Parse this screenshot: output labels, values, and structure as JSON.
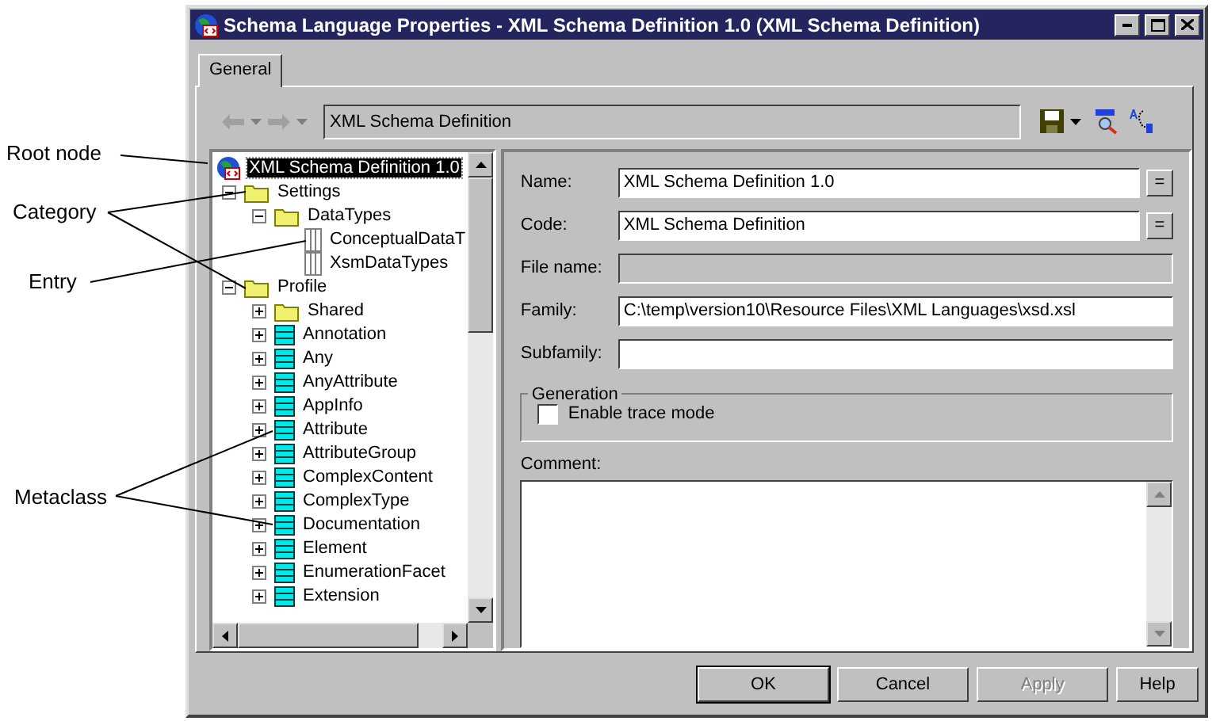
{
  "window": {
    "title": "Schema Language Properties - XML Schema Definition 1.0 (XML Schema Definition)"
  },
  "tabs": [
    {
      "label": "General",
      "selected": true
    }
  ],
  "toolbar": {
    "path": "XML Schema Definition"
  },
  "tree": [
    {
      "label": "XML Schema Definition 1.0",
      "kind": "root",
      "selected": true,
      "children": [
        {
          "label": "Settings",
          "kind": "folder",
          "expanded": true,
          "selected": false,
          "children": [
            {
              "label": "DataTypes",
              "kind": "folder",
              "expanded": true,
              "selected": false,
              "children": [
                {
                  "label": "ConceptualDataT",
                  "kind": "entry",
                  "selected": false
                },
                {
                  "label": "XsmDataTypes",
                  "kind": "entry",
                  "selected": false
                }
              ]
            }
          ]
        },
        {
          "label": "Profile",
          "kind": "folder",
          "expanded": true,
          "selected": false,
          "children": [
            {
              "label": "Shared",
              "kind": "folder",
              "expanded": false,
              "selected": false
            },
            {
              "label": "Annotation",
              "kind": "metaclass",
              "expanded": false,
              "selected": false
            },
            {
              "label": "Any",
              "kind": "metaclass",
              "expanded": false,
              "selected": false
            },
            {
              "label": "AnyAttribute",
              "kind": "metaclass",
              "expanded": false,
              "selected": false
            },
            {
              "label": "AppInfo",
              "kind": "metaclass",
              "expanded": false,
              "selected": false
            },
            {
              "label": "Attribute",
              "kind": "metaclass",
              "expanded": false,
              "selected": false
            },
            {
              "label": "AttributeGroup",
              "kind": "metaclass",
              "expanded": false,
              "selected": false
            },
            {
              "label": "ComplexContent",
              "kind": "metaclass",
              "expanded": false,
              "selected": false
            },
            {
              "label": "ComplexType",
              "kind": "metaclass",
              "expanded": false,
              "selected": false
            },
            {
              "label": "Documentation",
              "kind": "metaclass",
              "expanded": false,
              "selected": false
            },
            {
              "label": "Element",
              "kind": "metaclass",
              "expanded": false,
              "selected": false
            },
            {
              "label": "EnumerationFacet",
              "kind": "metaclass",
              "expanded": false,
              "selected": false
            },
            {
              "label": "Extension",
              "kind": "metaclass",
              "expanded": false,
              "selected": false
            }
          ]
        }
      ]
    }
  ],
  "fields": [
    {
      "label": "Name:",
      "value": "XML Schema Definition 1.0",
      "disabled": false,
      "button": "="
    },
    {
      "label": "Code:",
      "value": "XML Schema Definition",
      "disabled": false,
      "button": "="
    },
    {
      "label": "File name:",
      "disabled": true
    },
    {
      "label": "Family:",
      "value": "C:\\temp\\version10\\Resource Files\\XML Languages\\xsd.xsl",
      "disabled": false
    },
    {
      "label": "Subfamily:",
      "disabled": false
    }
  ],
  "generation": {
    "title": "Generation",
    "checkbox": {
      "label": "Enable trace mode",
      "checked": false
    }
  },
  "comment": {
    "label": "Comment:"
  },
  "buttons": [
    {
      "label": "OK",
      "default": true,
      "disabled": false
    },
    {
      "label": "Cancel",
      "default": false,
      "disabled": false
    },
    {
      "label": "Apply",
      "default": false,
      "disabled": true
    },
    {
      "label": "Help",
      "default": false,
      "disabled": false
    }
  ],
  "callouts": [
    {
      "text": "Root node"
    },
    {
      "text": "Category"
    },
    {
      "text": "Entry"
    },
    {
      "text": "Metaclass"
    }
  ]
}
